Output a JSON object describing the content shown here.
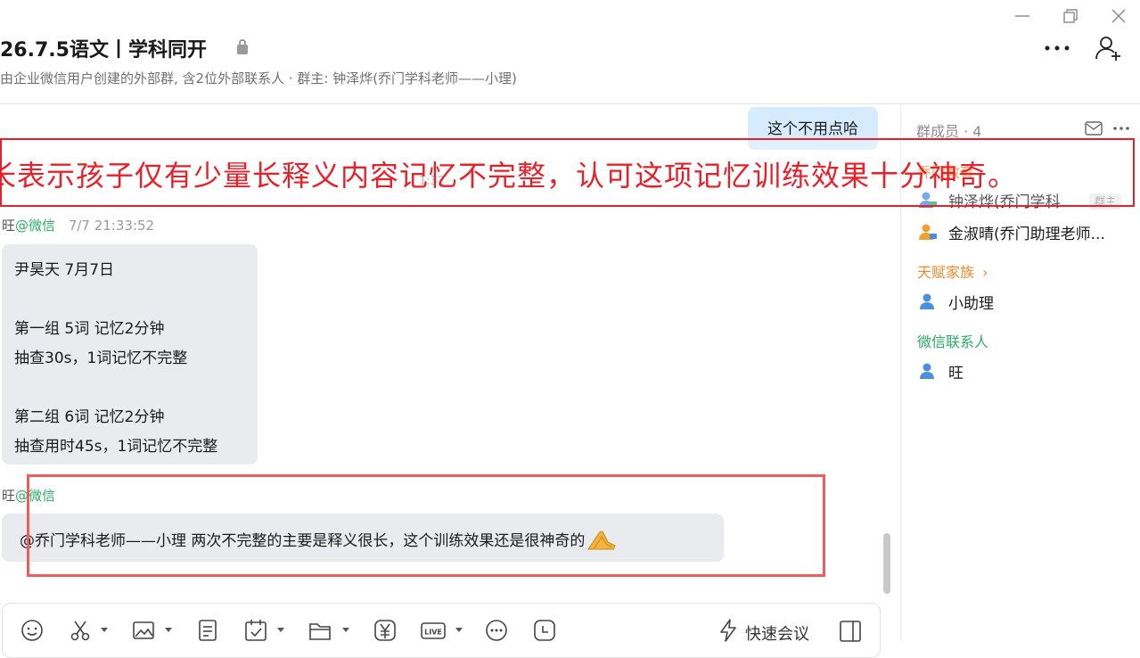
{
  "window": {
    "controls": [
      "minimize-icon",
      "restore-icon",
      "close-icon"
    ]
  },
  "header": {
    "title": "26.7.5语文丨学科同开",
    "subtitle": "由企业微信用户创建的外部群, 含2位外部联系人 · 群主: 钟泽烨(乔门学科老师——小理)"
  },
  "chat": {
    "right_bubble": "这个不用点哈",
    "faint_time": "1:32",
    "msg1": {
      "sender": "旺",
      "via": "@微信",
      "time": "7/7 21:33:52",
      "lines": [
        "尹昊天 7月7日",
        "",
        "第一组 5词  记忆2分钟",
        "抽查30s，1词记忆不完整",
        "",
        "第二组 6词 记忆2分钟",
        "抽查用时45s，1词记忆不完整"
      ]
    },
    "msg2": {
      "sender": "旺",
      "via": "@微信",
      "text": "@乔门学科老师——小理  两次不完整的主要是释义很长，这个训练效果还是很神奇的",
      "emoji": "praying-hands-icon"
    }
  },
  "toolbar": {
    "tools": [
      "smile-icon",
      "scissors-icon",
      "image-icon",
      "document-icon",
      "calendar-check-icon",
      "folder-icon",
      "yuan-icon",
      "live-icon",
      "more-circle-icon",
      "clock-icon"
    ],
    "quick_meeting": "快速会议"
  },
  "members": {
    "title": "群成员 · 4",
    "groups": [
      {
        "title": "乔门教育",
        "color": "#f08a2c",
        "members": [
          {
            "name": "钟泽烨(乔门学科...",
            "badge": "群主"
          },
          {
            "name": "金淑晴(乔门助理老师..."
          }
        ]
      },
      {
        "title": "天赋家族",
        "color": "#f08a2c",
        "members": [
          {
            "name": "小助理"
          }
        ]
      },
      {
        "title": "微信联系人",
        "color": "#2aae67",
        "members": [
          {
            "name": "旺"
          }
        ]
      }
    ]
  },
  "annotation": {
    "text": "长表示孩子仅有少量长释义内容记忆不完整，认可这项记忆训练效果十分神奇。",
    "color": "#e8202a"
  }
}
